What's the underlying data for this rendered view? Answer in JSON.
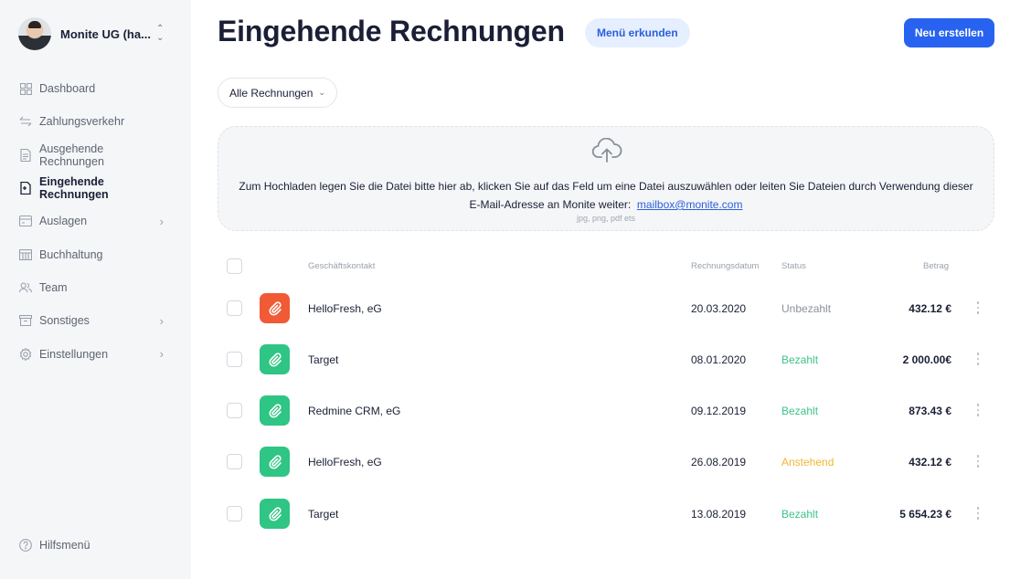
{
  "company": {
    "name": "Monite UG (ha..."
  },
  "nav": [
    {
      "label": "Dashboard",
      "icon": "dashboard-icon",
      "chevron": false,
      "active": false
    },
    {
      "label": "Zahlungsverkehr",
      "icon": "transfer-icon",
      "chevron": false,
      "active": false
    },
    {
      "label": "Ausgehende Rechnungen",
      "icon": "outgoing-invoice-icon",
      "chevron": false,
      "active": false
    },
    {
      "label": "Eingehende Rechnungen",
      "icon": "incoming-invoice-icon",
      "chevron": false,
      "active": true
    },
    {
      "label": "Auslagen",
      "icon": "expenses-icon",
      "chevron": true,
      "active": false
    },
    {
      "label": "Buchhaltung",
      "icon": "accounting-icon",
      "chevron": false,
      "active": false
    },
    {
      "label": "Team",
      "icon": "team-icon",
      "chevron": false,
      "active": false
    },
    {
      "label": "Sonstiges",
      "icon": "archive-icon",
      "chevron": true,
      "active": false
    },
    {
      "label": "Einstellungen",
      "icon": "gear-icon",
      "chevron": true,
      "active": false
    }
  ],
  "help": {
    "label": "Hilfsmenü"
  },
  "header": {
    "title": "Eingehende Rechnungen",
    "explore_label": "Menü erkunden",
    "new_label": "Neu erstellen"
  },
  "filter": {
    "label": "Alle Rechnungen"
  },
  "dropzone": {
    "line1": "Zum Hochladen legen Sie die Datei bitte hier ab, klicken Sie auf das Feld um eine Datei auszuwählen oder leiten Sie Dateien durch Verwendung dieser",
    "line2_prefix": "E-Mail-Adresse an Monite weiter:",
    "email": "mailbox@monite.com",
    "hint": "jpg, png, pdf ets"
  },
  "table": {
    "headers": {
      "contact": "Geschäftskontakt",
      "date": "Rechnungsdatum",
      "status": "Status",
      "amount": "Betrag"
    },
    "rows": [
      {
        "contact": "HelloFresh, eG",
        "date": "20.03.2020",
        "status": "Unbezahlt",
        "amount": "432.12 €",
        "icon_color": "#f05a35",
        "status_color": "#8a909b"
      },
      {
        "contact": "Target",
        "date": "08.01.2020",
        "status": "Bezahlt",
        "amount": "2 000.00€",
        "icon_color": "#2fc584",
        "status_color": "#3ec38a"
      },
      {
        "contact": "Redmine CRM, eG",
        "date": "09.12.2019",
        "status": "Bezahlt",
        "amount": "873.43 €",
        "icon_color": "#2fc584",
        "status_color": "#3ec38a"
      },
      {
        "contact": "HelloFresh, eG",
        "date": "26.08.2019",
        "status": "Anstehend",
        "amount": "432.12 €",
        "icon_color": "#2fc584",
        "status_color": "#f2b632"
      },
      {
        "contact": "Target",
        "date": "13.08.2019",
        "status": "Bezahlt",
        "amount": "5 654.23 €",
        "icon_color": "#2fc584",
        "status_color": "#3ec38a"
      }
    ]
  },
  "colors": {
    "accent": "#2763f0",
    "sidebar_bg": "#f5f6f8",
    "paid": "#3ec38a",
    "pending": "#f2b632",
    "unpaid": "#8a909b"
  }
}
